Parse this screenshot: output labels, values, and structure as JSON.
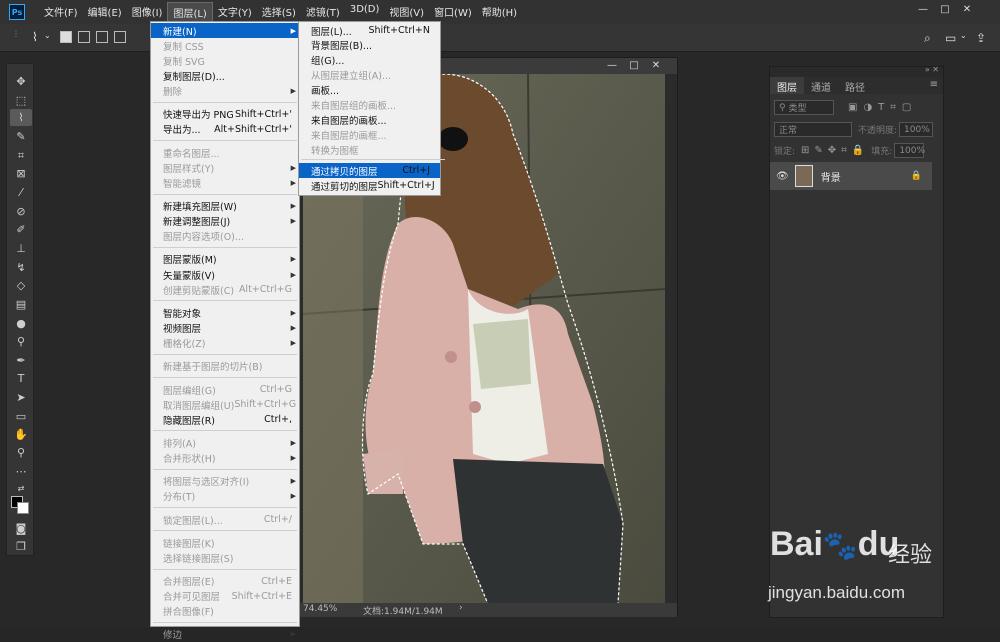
{
  "menubar": {
    "logo": "Ps",
    "items": [
      "文件(F)",
      "编辑(E)",
      "图像(I)",
      "图层(L)",
      "文字(Y)",
      "选择(S)",
      "滤镜(T)",
      "3D(D)",
      "视图(V)",
      "窗口(W)",
      "帮助(H)"
    ],
    "active_index": 3
  },
  "window_controls": {
    "minimize": "—",
    "maximize": "□",
    "close": "✕"
  },
  "doc_controls": {
    "minimize": "—",
    "maximize": "□",
    "close": "✕"
  },
  "layer_menu": [
    {
      "label": "新建(N)",
      "shortcut": "",
      "arrow": true,
      "state": "highlight"
    },
    {
      "label": "复制 CSS",
      "shortcut": "",
      "state": "disabled"
    },
    {
      "label": "复制 SVG",
      "shortcut": "",
      "state": "disabled"
    },
    {
      "label": "复制图层(D)...",
      "shortcut": "",
      "state": "normal"
    },
    {
      "label": "删除",
      "shortcut": "",
      "arrow": true,
      "state": "disabled"
    },
    {
      "sep": true
    },
    {
      "label": "快速导出为 PNG",
      "shortcut": "Shift+Ctrl+'",
      "state": "normal"
    },
    {
      "label": "导出为...",
      "shortcut": "Alt+Shift+Ctrl+'",
      "state": "normal"
    },
    {
      "sep": true
    },
    {
      "label": "重命名图层...",
      "shortcut": "",
      "state": "disabled"
    },
    {
      "label": "图层样式(Y)",
      "shortcut": "",
      "arrow": true,
      "state": "disabled"
    },
    {
      "label": "智能滤镜",
      "shortcut": "",
      "arrow": true,
      "state": "disabled"
    },
    {
      "sep": true
    },
    {
      "label": "新建填充图层(W)",
      "shortcut": "",
      "arrow": true,
      "state": "normal"
    },
    {
      "label": "新建调整图层(J)",
      "shortcut": "",
      "arrow": true,
      "state": "normal"
    },
    {
      "label": "图层内容选项(O)...",
      "shortcut": "",
      "state": "disabled"
    },
    {
      "sep": true
    },
    {
      "label": "图层蒙版(M)",
      "shortcut": "",
      "arrow": true,
      "state": "normal"
    },
    {
      "label": "矢量蒙版(V)",
      "shortcut": "",
      "arrow": true,
      "state": "normal"
    },
    {
      "label": "创建剪贴蒙版(C)",
      "shortcut": "Alt+Ctrl+G",
      "state": "disabled"
    },
    {
      "sep": true
    },
    {
      "label": "智能对象",
      "shortcut": "",
      "arrow": true,
      "state": "normal"
    },
    {
      "label": "视频图层",
      "shortcut": "",
      "arrow": true,
      "state": "normal"
    },
    {
      "label": "栅格化(Z)",
      "shortcut": "",
      "arrow": true,
      "state": "disabled"
    },
    {
      "sep": true
    },
    {
      "label": "新建基于图层的切片(B)",
      "shortcut": "",
      "state": "disabled"
    },
    {
      "sep": true
    },
    {
      "label": "图层编组(G)",
      "shortcut": "Ctrl+G",
      "state": "disabled"
    },
    {
      "label": "取消图层编组(U)",
      "shortcut": "Shift+Ctrl+G",
      "state": "disabled"
    },
    {
      "label": "隐藏图层(R)",
      "shortcut": "Ctrl+,",
      "state": "normal"
    },
    {
      "sep": true
    },
    {
      "label": "排列(A)",
      "shortcut": "",
      "arrow": true,
      "state": "disabled"
    },
    {
      "label": "合并形状(H)",
      "shortcut": "",
      "arrow": true,
      "state": "disabled"
    },
    {
      "sep": true
    },
    {
      "label": "将图层与选区对齐(I)",
      "shortcut": "",
      "arrow": true,
      "state": "disabled"
    },
    {
      "label": "分布(T)",
      "shortcut": "",
      "arrow": true,
      "state": "disabled"
    },
    {
      "sep": true
    },
    {
      "label": "锁定图层(L)...",
      "shortcut": "Ctrl+/",
      "state": "disabled"
    },
    {
      "sep": true
    },
    {
      "label": "链接图层(K)",
      "shortcut": "",
      "state": "disabled"
    },
    {
      "label": "选择链接图层(S)",
      "shortcut": "",
      "state": "disabled"
    },
    {
      "sep": true
    },
    {
      "label": "合并图层(E)",
      "shortcut": "Ctrl+E",
      "state": "disabled"
    },
    {
      "label": "合并可见图层",
      "shortcut": "Shift+Ctrl+E",
      "state": "disabled"
    },
    {
      "label": "拼合图像(F)",
      "shortcut": "",
      "state": "disabled"
    },
    {
      "sep": true
    },
    {
      "label": "修边",
      "shortcut": "",
      "arrow": true,
      "state": "disabled"
    }
  ],
  "new_submenu": [
    {
      "label": "图层(L)...",
      "shortcut": "Shift+Ctrl+N",
      "state": "normal"
    },
    {
      "label": "背景图层(B)...",
      "shortcut": "",
      "state": "normal"
    },
    {
      "label": "组(G)...",
      "shortcut": "",
      "state": "normal"
    },
    {
      "label": "从图层建立组(A)...",
      "shortcut": "",
      "state": "disabled"
    },
    {
      "label": "画板...",
      "shortcut": "",
      "state": "normal"
    },
    {
      "label": "来自图层组的画板...",
      "shortcut": "",
      "state": "disabled"
    },
    {
      "label": "来自图层的画板...",
      "shortcut": "",
      "state": "normal"
    },
    {
      "label": "来自图层的画框...",
      "shortcut": "",
      "state": "disabled"
    },
    {
      "label": "转换为图框",
      "shortcut": "",
      "state": "disabled"
    },
    {
      "sep": true
    },
    {
      "label": "通过拷贝的图层",
      "shortcut": "Ctrl+J",
      "state": "highlight"
    },
    {
      "label": "通过剪切的图层",
      "shortcut": "Shift+Ctrl+J",
      "state": "normal"
    }
  ],
  "layers_panel": {
    "tabs": [
      "图层",
      "通道",
      "路径"
    ],
    "kind_placeholder": "类型",
    "blend_mode": "正常",
    "opacity_label": "不透明度:",
    "opacity_value": "100%",
    "lock_label": "锁定:",
    "fill_label": "填充:",
    "fill_value": "100%",
    "layer_name": "背景"
  },
  "status": {
    "zoom": "74.45%",
    "doc": "文档:1.94M/1.94M"
  },
  "watermark": {
    "brand_a": "Bai",
    "brand_b": "du",
    "brand_cn": "经验",
    "url": "jingyan.baidu.com"
  }
}
